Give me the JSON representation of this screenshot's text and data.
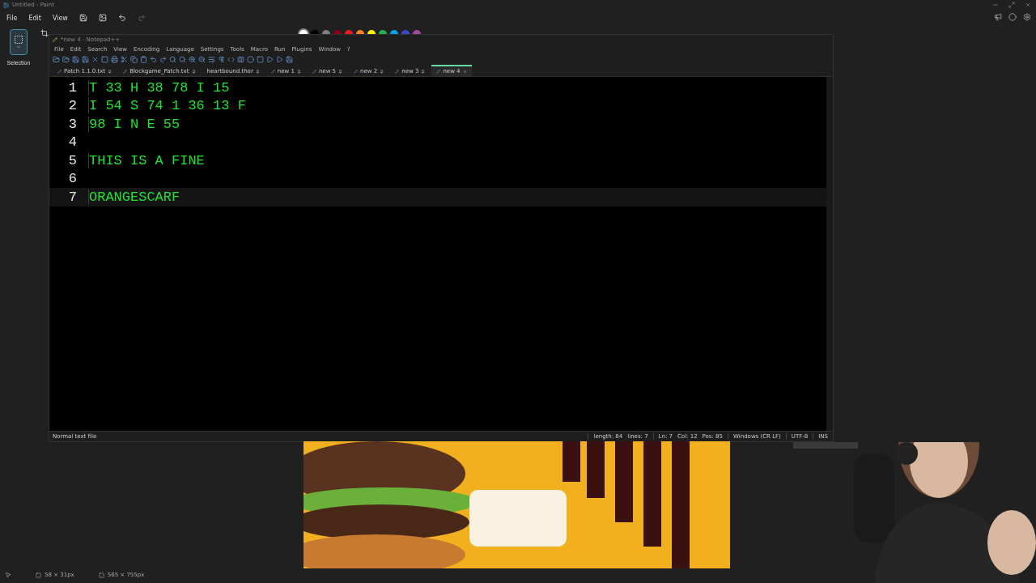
{
  "paint": {
    "title": "Untitled - Paint",
    "menu": [
      "File",
      "Edit",
      "View"
    ],
    "tool": {
      "label": "Selection",
      "selected": true
    },
    "palette": [
      {
        "color": "#ffffff",
        "selected": true
      },
      {
        "color": "#000000",
        "selected": false
      },
      {
        "color": "#7f7f7f",
        "selected": false
      },
      {
        "color": "#880015",
        "selected": false
      },
      {
        "color": "#ed1c24",
        "selected": false
      },
      {
        "color": "#ff7f27",
        "selected": false
      },
      {
        "color": "#fff200",
        "selected": false
      },
      {
        "color": "#22b14c",
        "selected": false
      },
      {
        "color": "#00a2e8",
        "selected": false
      },
      {
        "color": "#3f48cc",
        "selected": false
      },
      {
        "color": "#a349a4",
        "selected": false
      }
    ],
    "status": [
      "58 × 31px",
      "565 × 755px"
    ]
  },
  "editor": {
    "title": "*new 4 - Notepad++",
    "menu": [
      "File",
      "Edit",
      "Search",
      "View",
      "Encoding",
      "Language",
      "Settings",
      "Tools",
      "Macro",
      "Run",
      "Plugins",
      "Window",
      "?"
    ],
    "tabs": [
      {
        "label": "Patch 1.1.0.txt",
        "selected": false,
        "edited": true
      },
      {
        "label": "Blockgame_Patch.txt",
        "selected": false,
        "edited": true
      },
      {
        "label": "heartbound.thor",
        "selected": false,
        "edited": false
      },
      {
        "label": "new 1",
        "selected": false,
        "edited": true
      },
      {
        "label": "new 5",
        "selected": false,
        "edited": true
      },
      {
        "label": "new 2",
        "selected": false,
        "edited": true
      },
      {
        "label": "new 3",
        "selected": false,
        "edited": true
      },
      {
        "label": "new 4",
        "selected": true,
        "edited": true
      }
    ],
    "lines": [
      {
        "number": "1",
        "text": "T 33 H 38 78 I 15",
        "current": false
      },
      {
        "number": "2",
        "text": "I 54 S 74 1 36 13 F",
        "current": false
      },
      {
        "number": "3",
        "text": "98 I N E 55",
        "current": false
      },
      {
        "number": "4",
        "current": false
      },
      {
        "number": "5",
        "text": "THIS IS A FINE",
        "current": false
      },
      {
        "number": "6",
        "current": false
      },
      {
        "number": "7",
        "text": "ORANGESCARF",
        "current": true
      }
    ],
    "status": {
      "type": "Normal text file",
      "length": "length: 84",
      "lines": "lines: 7",
      "position": [
        "Ln: 7",
        "Col: 12",
        "Pos: 85"
      ],
      "eol": "Windows (CR LF)",
      "encoding": "UTF-8",
      "mode": "INS"
    }
  }
}
